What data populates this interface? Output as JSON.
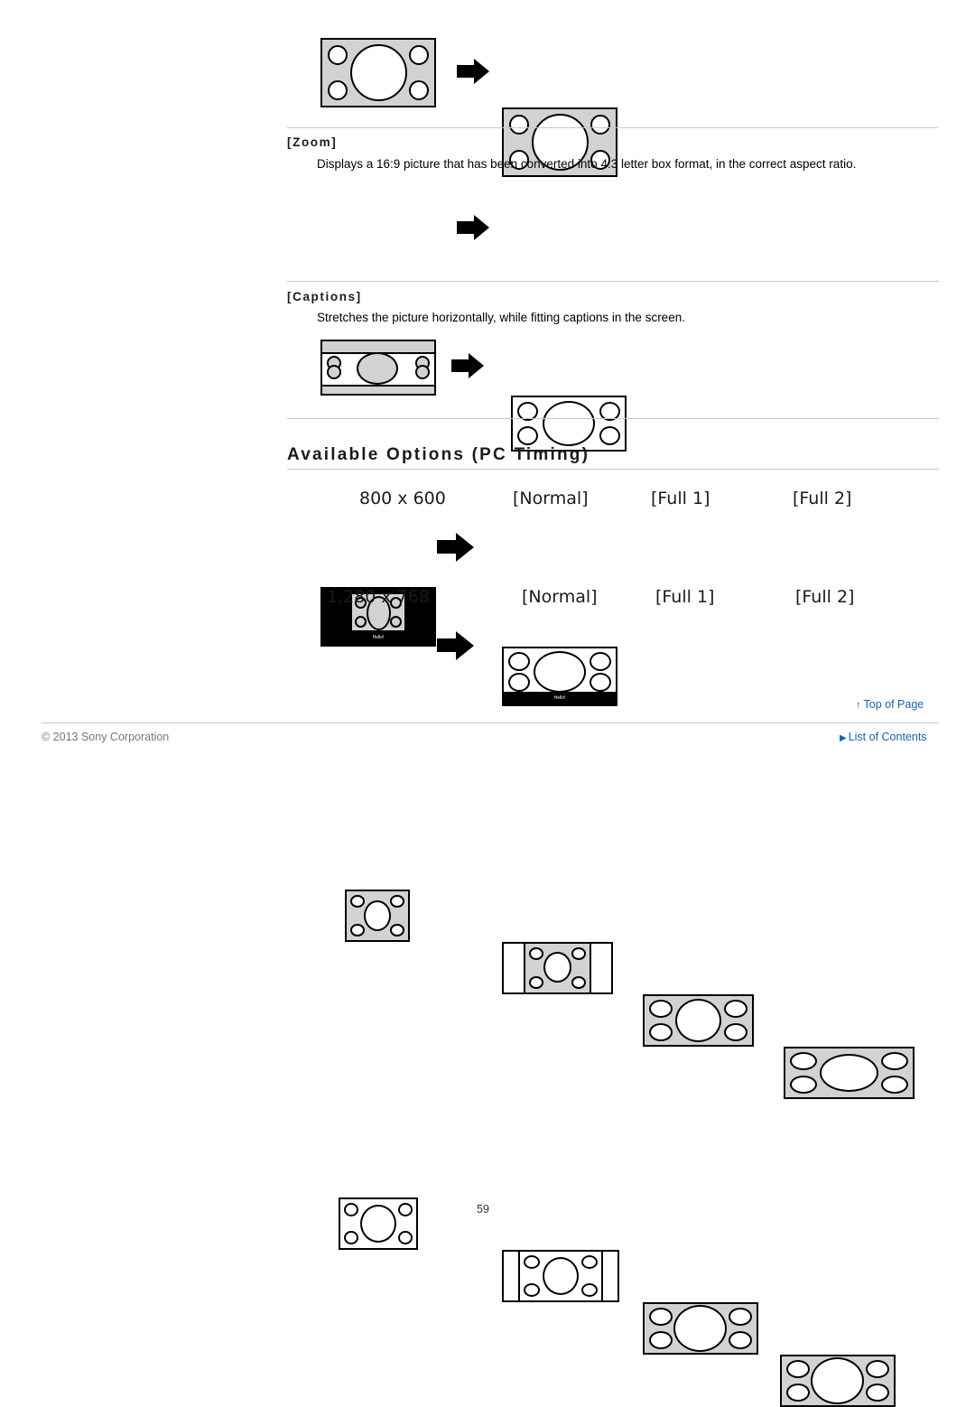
{
  "options": [
    {
      "name": "[Zoom]",
      "description": "Displays a 16:9 picture that has been converted into 4:3 letter box format, in the correct aspect ratio."
    },
    {
      "name": "[Captions]",
      "description": "Stretches the picture horizontally, while fitting captions in the screen."
    }
  ],
  "caption_text": "Hello!",
  "section": {
    "title": "Available Options (PC Timing)",
    "rows": [
      {
        "resolution": "800 x 600",
        "modes": [
          "[Normal]",
          "[Full 1]",
          "[Full 2]"
        ]
      },
      {
        "resolution": "1,280 x 768",
        "modes": [
          "[Normal]",
          "[Full 1]",
          "[Full 2]"
        ]
      }
    ]
  },
  "footer": {
    "copyright": "© 2013 Sony Corporation",
    "top_of_page": "Top of Page",
    "list_of_contents": "List of Contents",
    "page_number": "59"
  }
}
